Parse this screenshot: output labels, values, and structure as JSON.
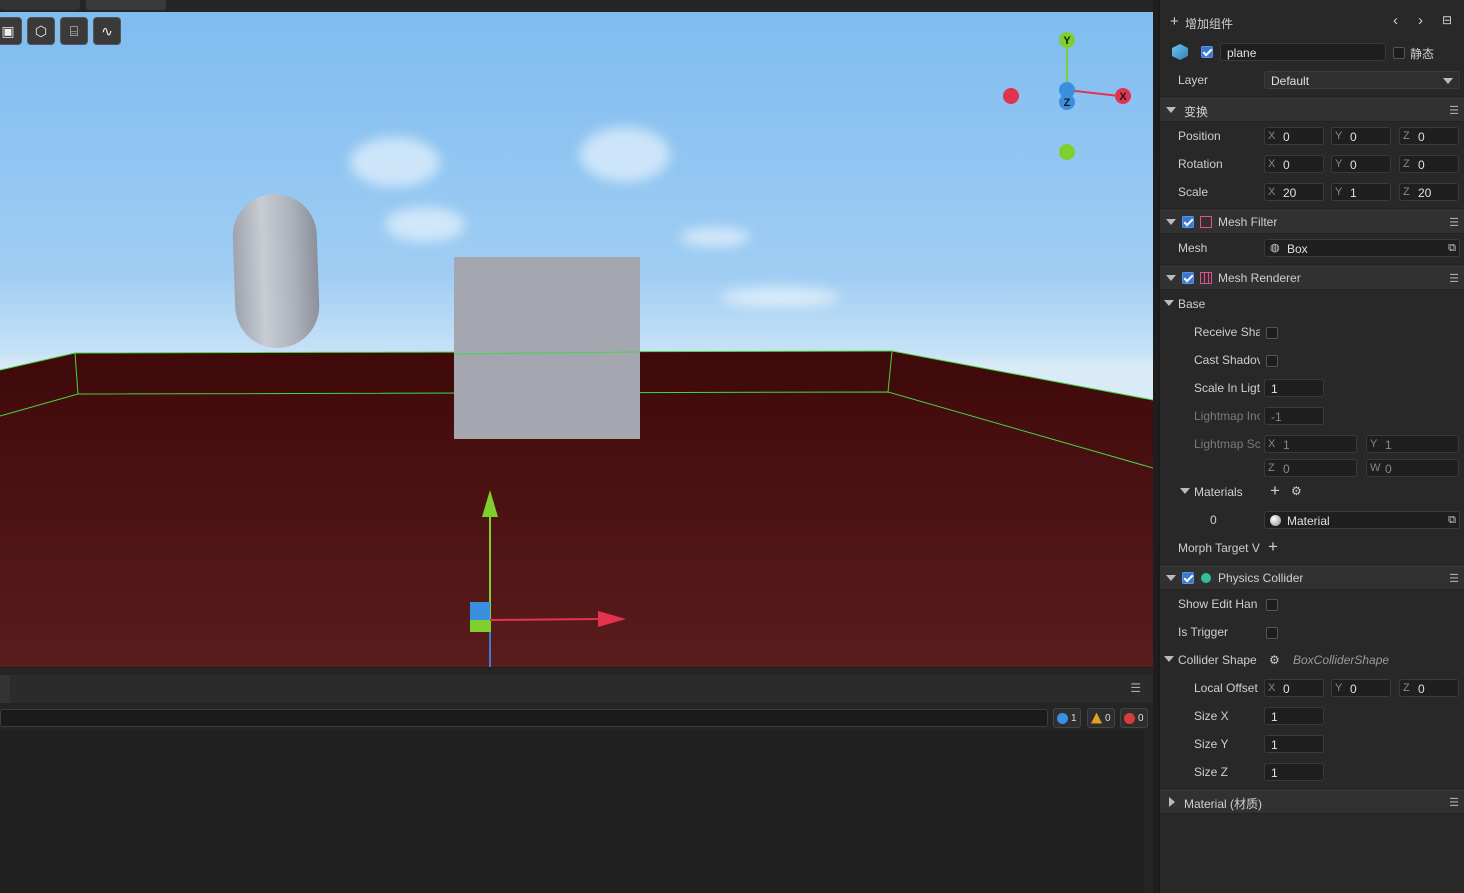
{
  "viewport": {
    "tool_icons": [
      "frame-icon",
      "cube-icon",
      "camera-icon",
      "stats-icon"
    ],
    "gizmo": {
      "y": "Y",
      "x": "X",
      "z": "Z"
    },
    "colors": {
      "ground": "#4a0c0c",
      "sky": "#8ec5f2",
      "edge": "#46d646"
    }
  },
  "console": {
    "counts": {
      "info": "1",
      "warn": "0",
      "error": "0"
    }
  },
  "inspector": {
    "add_component": "增加组件",
    "node_name": "plane",
    "static_label": "静态",
    "layer": {
      "label": "Layer",
      "value": "Default"
    },
    "transform": {
      "title": "变换",
      "rows": [
        {
          "label": "Position",
          "x": "0",
          "y": "0",
          "z": "0"
        },
        {
          "label": "Rotation",
          "x": "0",
          "y": "0",
          "z": "0"
        },
        {
          "label": "Scale",
          "x": "20",
          "y": "1",
          "z": "20"
        }
      ]
    },
    "mesh_filter": {
      "title": "Mesh Filter",
      "mesh_label": "Mesh",
      "mesh_value": "Box"
    },
    "mesh_renderer": {
      "title": "Mesh Renderer",
      "base": "Base",
      "receive_shadow": "Receive Sha",
      "cast_shadow": "Cast Shadov",
      "scale_lightmap": {
        "label": "Scale In Ligt",
        "value": "1"
      },
      "lightmap_index": {
        "label": "Lightmap Inc",
        "value": "-1"
      },
      "lightmap_scale": {
        "label": "Lightmap Sc",
        "x": "1",
        "y": "1",
        "z": "0",
        "w": "0"
      },
      "materials": "Materials",
      "material_index": "0",
      "material_value": "Material",
      "morph": "Morph Target V"
    },
    "physics_collider": {
      "title": "Physics Collider",
      "show_edit": "Show Edit Han",
      "is_trigger": "Is Trigger",
      "collider_shape": "Collider Shape",
      "shape_value": "BoxColliderShape",
      "local_offset": {
        "label": "Local Offset",
        "x": "0",
        "y": "0",
        "z": "0"
      },
      "size_x": {
        "label": "Size X",
        "value": "1"
      },
      "size_y": {
        "label": "Size Y",
        "value": "1"
      },
      "size_z": {
        "label": "Size Z",
        "value": "1"
      }
    },
    "material_section": "Material (材质)"
  }
}
